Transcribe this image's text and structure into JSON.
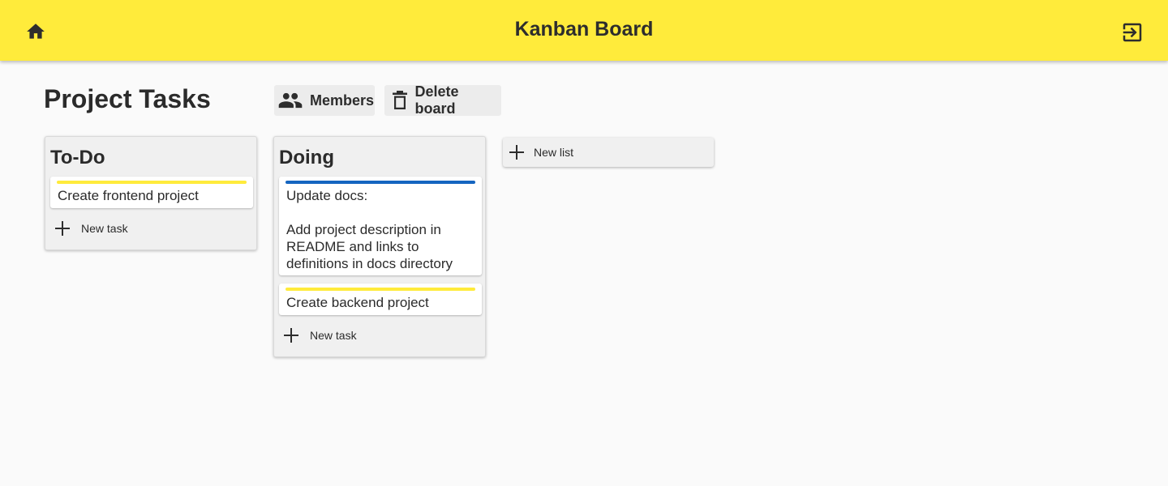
{
  "header": {
    "title": "Kanban Board",
    "home_icon": "home-icon",
    "exit_icon": "exit-to-app-icon",
    "background_color": "#ffeb3b"
  },
  "board": {
    "title": "Project Tasks",
    "members_label": "Members",
    "members_icon": "people-icon",
    "delete_label": "Delete board",
    "delete_icon": "trash-icon"
  },
  "lists": [
    {
      "title": "To-Do",
      "cards": [
        {
          "text": "Create frontend project",
          "color": "#ffeb3b"
        }
      ],
      "new_task_label": "New task"
    },
    {
      "title": "Doing",
      "cards": [
        {
          "text": "Update docs:\n\nAdd project description in README and links to definitions in docs directory",
          "color": "#1565c0"
        },
        {
          "text": "Create backend project",
          "color": "#ffeb3b"
        }
      ],
      "new_task_label": "New task"
    }
  ],
  "new_list_label": "New list",
  "plus_icon": "plus-icon"
}
